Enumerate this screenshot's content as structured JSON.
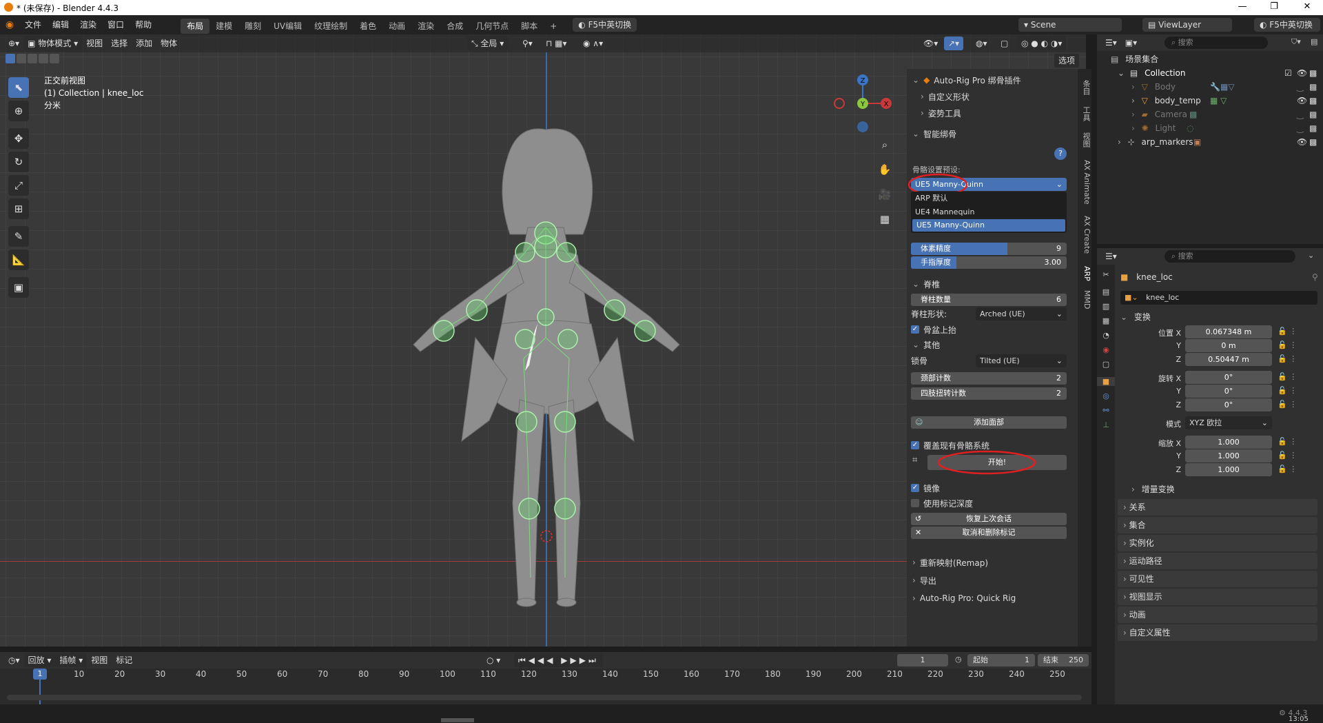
{
  "window": {
    "title": "* (未保存) - Blender 4.4.3"
  },
  "topbar": {
    "menus": [
      "文件",
      "编辑",
      "渲染",
      "窗口",
      "帮助"
    ],
    "workspaces": [
      "布局",
      "建模",
      "雕刻",
      "UV编辑",
      "纹理绘制",
      "着色",
      "动画",
      "渲染",
      "合成",
      "几何节点",
      "脚本"
    ],
    "add_tab": "+",
    "ime_toggle": "F5中英切换",
    "scene": "Scene",
    "view_layer": "ViewLayer",
    "ime_toggle_right": "F5中英切换"
  },
  "viewport": {
    "mode": "物体模式",
    "menus": [
      "视图",
      "选择",
      "添加",
      "物体"
    ],
    "orientation": "全局",
    "options": "选项",
    "info_line1": "正交前视图",
    "info_line2": "(1) Collection | knee_loc",
    "info_line3": "分米",
    "gizmo": {
      "z": "Z",
      "y": "Y",
      "x": "X"
    }
  },
  "npanel": {
    "addon_title": "Auto-Rig Pro 绑骨插件",
    "custom_shapes": "自定义形状",
    "pose_tools": "姿势工具",
    "smart_rig": "智能绑骨",
    "preset_label": "骨骼设置预设:",
    "preset_value": "UE5 Manny-Quinn",
    "preset_options": [
      "ARP 默认",
      "UE4 Mannequin",
      "UE5 Manny-Quinn"
    ],
    "voxel_label": "体素精度",
    "voxel_value": "9",
    "finger_label": "手指厚度",
    "finger_value": "3.00",
    "spine_section": "脊椎",
    "spine_count_label": "脊柱数量",
    "spine_count_value": "6",
    "spine_shape_label": "脊柱形状:",
    "spine_shape_value": "Arched (UE)",
    "pelvis_up": "骨盆上抬",
    "other_section": "其他",
    "clavicle_label": "锁骨",
    "clavicle_value": "Tilted (UE)",
    "neck_label": "颈部计数",
    "neck_value": "2",
    "twist_label": "四肢扭转计数",
    "twist_value": "2",
    "add_face": "添加面部",
    "overwrite": "覆盖现有骨骼系统",
    "start": "开始!",
    "mirror": "镜像",
    "marker_depth": "使用标记深度",
    "restore": "恢复上次会话",
    "cancel_markers": "取消和删除标记",
    "remap": "重新映射(Remap)",
    "export": "导出",
    "quick_rig": "Auto-Rig Pro: Quick Rig"
  },
  "vtabs": [
    "条目",
    "工具",
    "视图",
    "AX Animate",
    "AX Create",
    "ARP",
    "MMD"
  ],
  "outliner": {
    "search_placeholder": "搜索",
    "scene_collection": "场景集合",
    "rows": [
      "Collection",
      "Body",
      "body_temp",
      "Camera",
      "Light",
      "arp_markers"
    ]
  },
  "properties": {
    "search_placeholder": "搜索",
    "object_name": "knee_loc",
    "object_field": "knee_loc",
    "transform": "变换",
    "location_label": "位置",
    "loc_x": "0.067348 m",
    "loc_y": "0 m",
    "loc_z": "0.50447 m",
    "rotation_label": "旋转",
    "rot_x": "0°",
    "rot_y": "0°",
    "rot_z": "0°",
    "mode_label": "模式",
    "mode_value": "XYZ 欧拉",
    "scale_label": "缩放",
    "scale_x": "1.000",
    "scale_y": "1.000",
    "scale_z": "1.000",
    "axis_x": "X",
    "axis_y": "Y",
    "axis_z": "Z",
    "delta": "增量变换",
    "sections": [
      "关系",
      "集合",
      "实例化",
      "运动路径",
      "可见性",
      "视图显示",
      "动画",
      "自定义属性"
    ]
  },
  "timeline": {
    "menus": [
      "回放",
      "插帧",
      "视图",
      "标记"
    ],
    "current_frame": "1",
    "start_label": "起始",
    "start_value": "1",
    "end_label": "结束",
    "end_value": "250",
    "frames": [
      "1",
      "10",
      "20",
      "30",
      "40",
      "50",
      "60",
      "70",
      "80",
      "90",
      "100",
      "110",
      "120",
      "130",
      "140",
      "150",
      "160",
      "170",
      "180",
      "190",
      "200",
      "210",
      "220",
      "230",
      "240",
      "250"
    ]
  },
  "statusbar": {
    "version": "4.4.3",
    "clock": "13:05"
  },
  "colors": {
    "accent": "#4772b3",
    "annotation": "#e02020",
    "bone": "#62d86a"
  }
}
